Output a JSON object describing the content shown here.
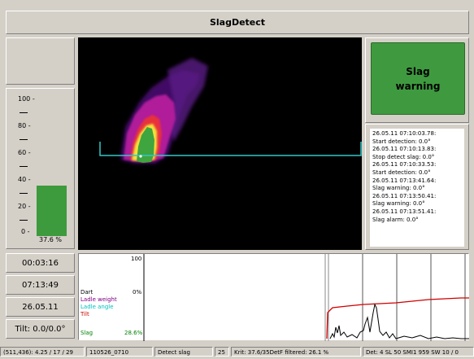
{
  "window": {
    "title": "SlagDetect"
  },
  "gauge": {
    "ticks": [
      "100 -",
      "80 -",
      "60 -",
      "40 -",
      "20 -",
      "0 -"
    ],
    "value": 37.6,
    "percent_label": "37.6 %",
    "bar_color": "#3d9a3d"
  },
  "warning": {
    "label": "Slag warning",
    "color": "#3f9a3f"
  },
  "log": {
    "entries": [
      "26.05.11 07:10:03.78:",
      "Start detection: 0.0°",
      "26.05.11 07:10:13.83:",
      "Stop detect slag: 0.0°",
      "26.05.11 07:10:33.53:",
      "Start detection: 0.0°",
      "26.05.11 07:13:41.64:",
      "Slag warning: 0.0°",
      "26.05.11 07:13:50.41:",
      "Slag warning: 0.0°",
      "26.05.11 07:13:51.41:",
      "Slag alarm: 0.0°"
    ]
  },
  "info": {
    "elapsed": "00:03:16",
    "time": "07:13:49",
    "date": "26.05.11",
    "tilt": "Tilt: 0.0/0.0°"
  },
  "trend": {
    "scale_max": "100",
    "labels": {
      "dart": "Dart",
      "dart_value": "0%",
      "ladle_weight": "Ladle weight",
      "ladle_angle": "Ladle angle",
      "tilt": "Tilt",
      "slag": "Slag",
      "slag_value": "28.6%"
    },
    "colors": {
      "dart": "#000000",
      "ladle_weight": "#800080",
      "ladle_angle": "#00c0c0",
      "tilt": "#d00000",
      "slag": "#008000"
    }
  },
  "status_bar": {
    "coords": "(511,436): 4.25 / 17 / 29",
    "file": "110526_0710",
    "mode": "Detect slag",
    "count": "25",
    "krit": "Krit: 37.6/35DetF filtered: 26.1 %",
    "det": "Det: 4 SL 50 SMI1 959 SW 10 / 0"
  }
}
